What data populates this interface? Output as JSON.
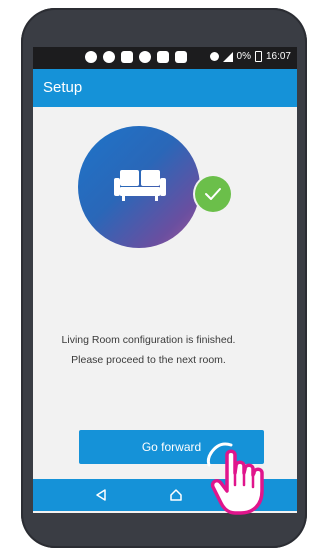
{
  "status_bar": {
    "battery_text": "0%",
    "time": "16:07",
    "icons": [
      "message-icon",
      "app-icon",
      "file-icon",
      "photo-icon",
      "f-icon",
      "f-icon",
      "alarm-icon",
      "signal-icon",
      "battery-icon"
    ]
  },
  "app_bar": {
    "title": "Setup"
  },
  "main": {
    "illustration": {
      "icon": "sofa-icon",
      "badge": "check-icon"
    },
    "message_line1": "Living Room configuration is finished.",
    "message_line2": "Please proceed to the next room.",
    "primary_button": "Go forward"
  },
  "nav_bar": {
    "items": [
      "back-icon",
      "home-icon"
    ]
  },
  "overlay": {
    "icon": "tap-hand-icon"
  },
  "colors": {
    "primary": "#1592d8",
    "success": "#6bbf4a",
    "gradient_start": "#1e74c9",
    "gradient_end": "#a25c9a"
  }
}
